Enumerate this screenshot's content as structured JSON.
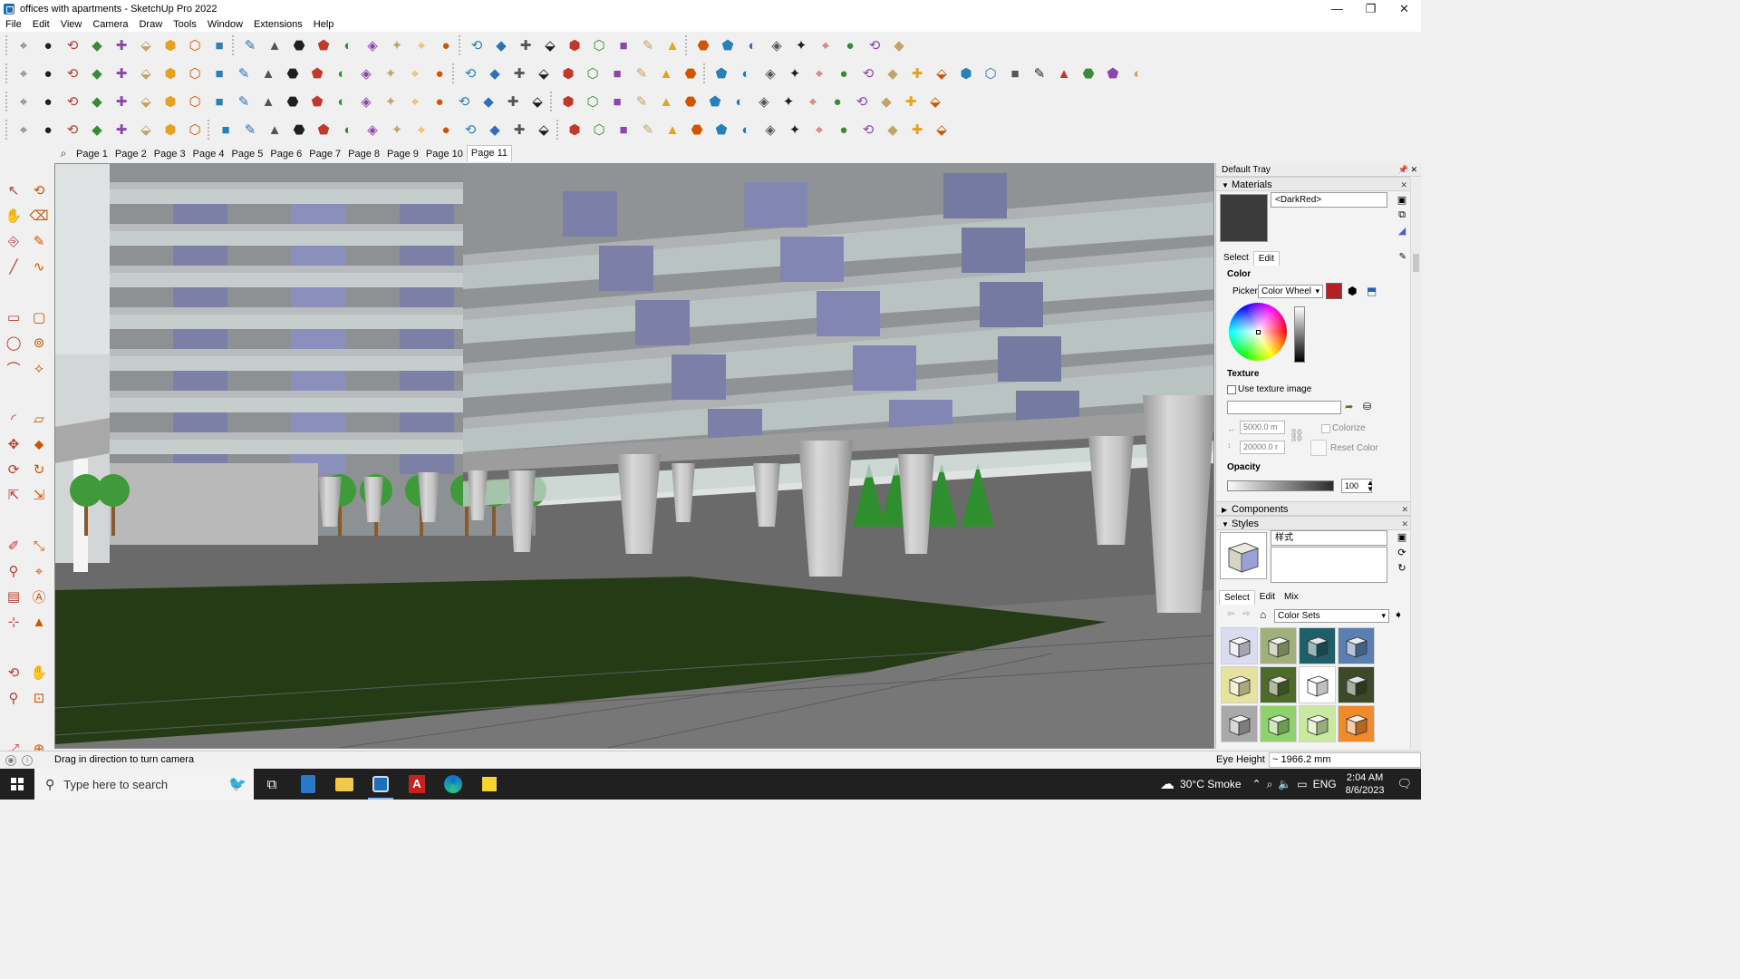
{
  "window": {
    "title": "offices with apartments - SketchUp Pro 2022",
    "minimize": "—",
    "maximize": "❐",
    "close": "✕"
  },
  "menu": [
    "File",
    "Edit",
    "View",
    "Camera",
    "Draw",
    "Tools",
    "Window",
    "Extensions",
    "Help"
  ],
  "scenes": {
    "tabs": [
      "Page 1",
      "Page 2",
      "Page 3",
      "Page 4",
      "Page 5",
      "Page 6",
      "Page 7",
      "Page 8",
      "Page 9",
      "Page 10",
      "Page 11"
    ],
    "active_index": 10
  },
  "tray": {
    "title": "Default Tray",
    "materials": {
      "header": "Materials",
      "current_material": "<DarkRed>",
      "swatch_color": "#3b3b3b",
      "tabs": [
        "Select",
        "Edit"
      ],
      "active_tab": "Edit",
      "color_label": "Color",
      "picker_label": "Picker:",
      "picker_value": "Color Wheel",
      "picker_color": "#b22222",
      "texture_label": "Texture",
      "use_texture_label": "Use texture image",
      "width_value": "5000.0 m",
      "height_value": "20000.0 r",
      "colorize_label": "Colorize",
      "reset_color_label": "Reset Color",
      "opacity_label": "Opacity",
      "opacity_value": "100"
    },
    "components": {
      "header": "Components"
    },
    "styles": {
      "header": "Styles",
      "style_name": "样式",
      "tabs": [
        "Select",
        "Edit",
        "Mix"
      ],
      "active_tab": "Select",
      "collection": "Color Sets",
      "thumbnail_colors": [
        [
          "#dcdcf0",
          "#9fb07a",
          "#1f5f6a",
          "#5a7fb0"
        ],
        [
          "#e6e2a0",
          "#4f6b2a",
          "#ffffff",
          "#3c4a2a"
        ],
        [
          "#a9a9a9",
          "#8fd16b",
          "#c9e8a0",
          "#f08a2a"
        ]
      ]
    }
  },
  "status": {
    "message": "Drag in direction to turn camera",
    "measure_label": "Eye Height",
    "measure_value": "~ 1966.2 mm"
  },
  "taskbar": {
    "search_placeholder": "Type here to search",
    "weather": "30°C  Smoke",
    "language": "ENG",
    "time": "2:04 AM",
    "date": "8/6/2023"
  }
}
